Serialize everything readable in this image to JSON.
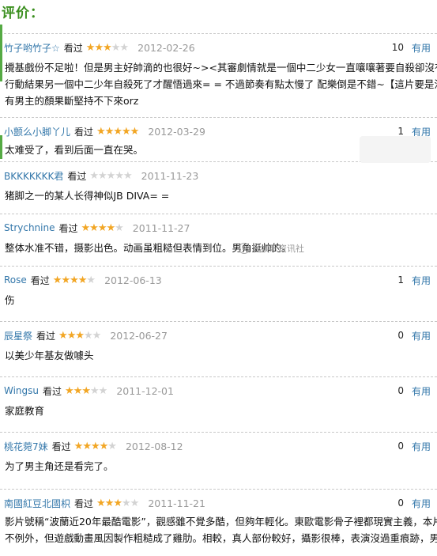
{
  "heading": "评价：",
  "useful_label": "有用",
  "watermark": "轻娱乐资讯社",
  "colors": {
    "accent": "#3b8f1f",
    "link": "#3377aa",
    "star_on": "#f2a624",
    "star_off": "#d3d3d3"
  },
  "reviews": [
    {
      "user": "竹子哟竹子☆",
      "verb": "看过",
      "stars": [
        true,
        true,
        true,
        false,
        false
      ],
      "date": "2012-02-26",
      "useful_count": "10",
      "lines": [
        "攪基戲份不足啦！但是男主好帥滴的也很好~><其審劇情就是一個中二少女一直嚷嚷著要自殺卻沒有",
        "行動結果另一個中二少年自殺死了才醒悟過來= = 不過節奏有點太慢了 配樂倒是不錯~【這片要是沒",
        "有男主的顏果斷堅持不下來orz"
      ]
    },
    {
      "user": "小颤么小脚丫儿",
      "verb": "看过",
      "stars": [
        true,
        true,
        true,
        true,
        true
      ],
      "date": "2012-03-29",
      "useful_count": "1",
      "lines": [
        "太难受了，看到后面一直在哭。"
      ]
    },
    {
      "user": "BKKKKKKK君",
      "verb": "看过",
      "stars": [
        false,
        false,
        false,
        false,
        false
      ],
      "date": "2011-11-23",
      "useful_count": "",
      "lines": [
        "猪脚之一的某人长得神似JB DIVA= ="
      ]
    },
    {
      "user": "Strychnine",
      "verb": "看过",
      "stars": [
        true,
        true,
        true,
        true,
        false
      ],
      "date": "2011-11-27",
      "useful_count": "",
      "lines": [
        "整体水准不错，摄影出色。动画虽粗糙但表情到位。男角挺帅的。"
      ]
    },
    {
      "user": "Rose",
      "verb": "看过",
      "stars": [
        true,
        true,
        true,
        true,
        false
      ],
      "date": "2012-06-13",
      "useful_count": "1",
      "lines": [
        "伤"
      ]
    },
    {
      "user": "辰星祭",
      "verb": "看过",
      "stars": [
        true,
        true,
        true,
        false,
        false
      ],
      "date": "2012-06-27",
      "useful_count": "0",
      "lines": [
        "以美少年基友做噱头"
      ]
    },
    {
      "user": "Wingsu",
      "verb": "看过",
      "stars": [
        true,
        true,
        true,
        false,
        false
      ],
      "date": "2011-12-01",
      "useful_count": "0",
      "lines": [
        "家庭教育"
      ]
    },
    {
      "user": "桃花菀7妹",
      "verb": "看过",
      "stars": [
        true,
        true,
        true,
        true,
        false
      ],
      "date": "2012-08-12",
      "useful_count": "0",
      "lines": [
        "为了男主角还是看完了。"
      ]
    },
    {
      "user": "南國紅豆北國枳",
      "verb": "看过",
      "stars": [
        true,
        true,
        true,
        false,
        false
      ],
      "date": "2011-11-21",
      "useful_count": "0",
      "lines": [
        "影片號稱“波蘭近20年最酷電影”，觀感雖不覺多酷，但夠年輕化。東歐電影骨子裡都現實主義，本片",
        "不例外，但遊戲動畫風因製作粗糙成了雞肋。相較，真人部份較好，攝影很棒，表演沒過重痕跡，男"
      ]
    }
  ]
}
